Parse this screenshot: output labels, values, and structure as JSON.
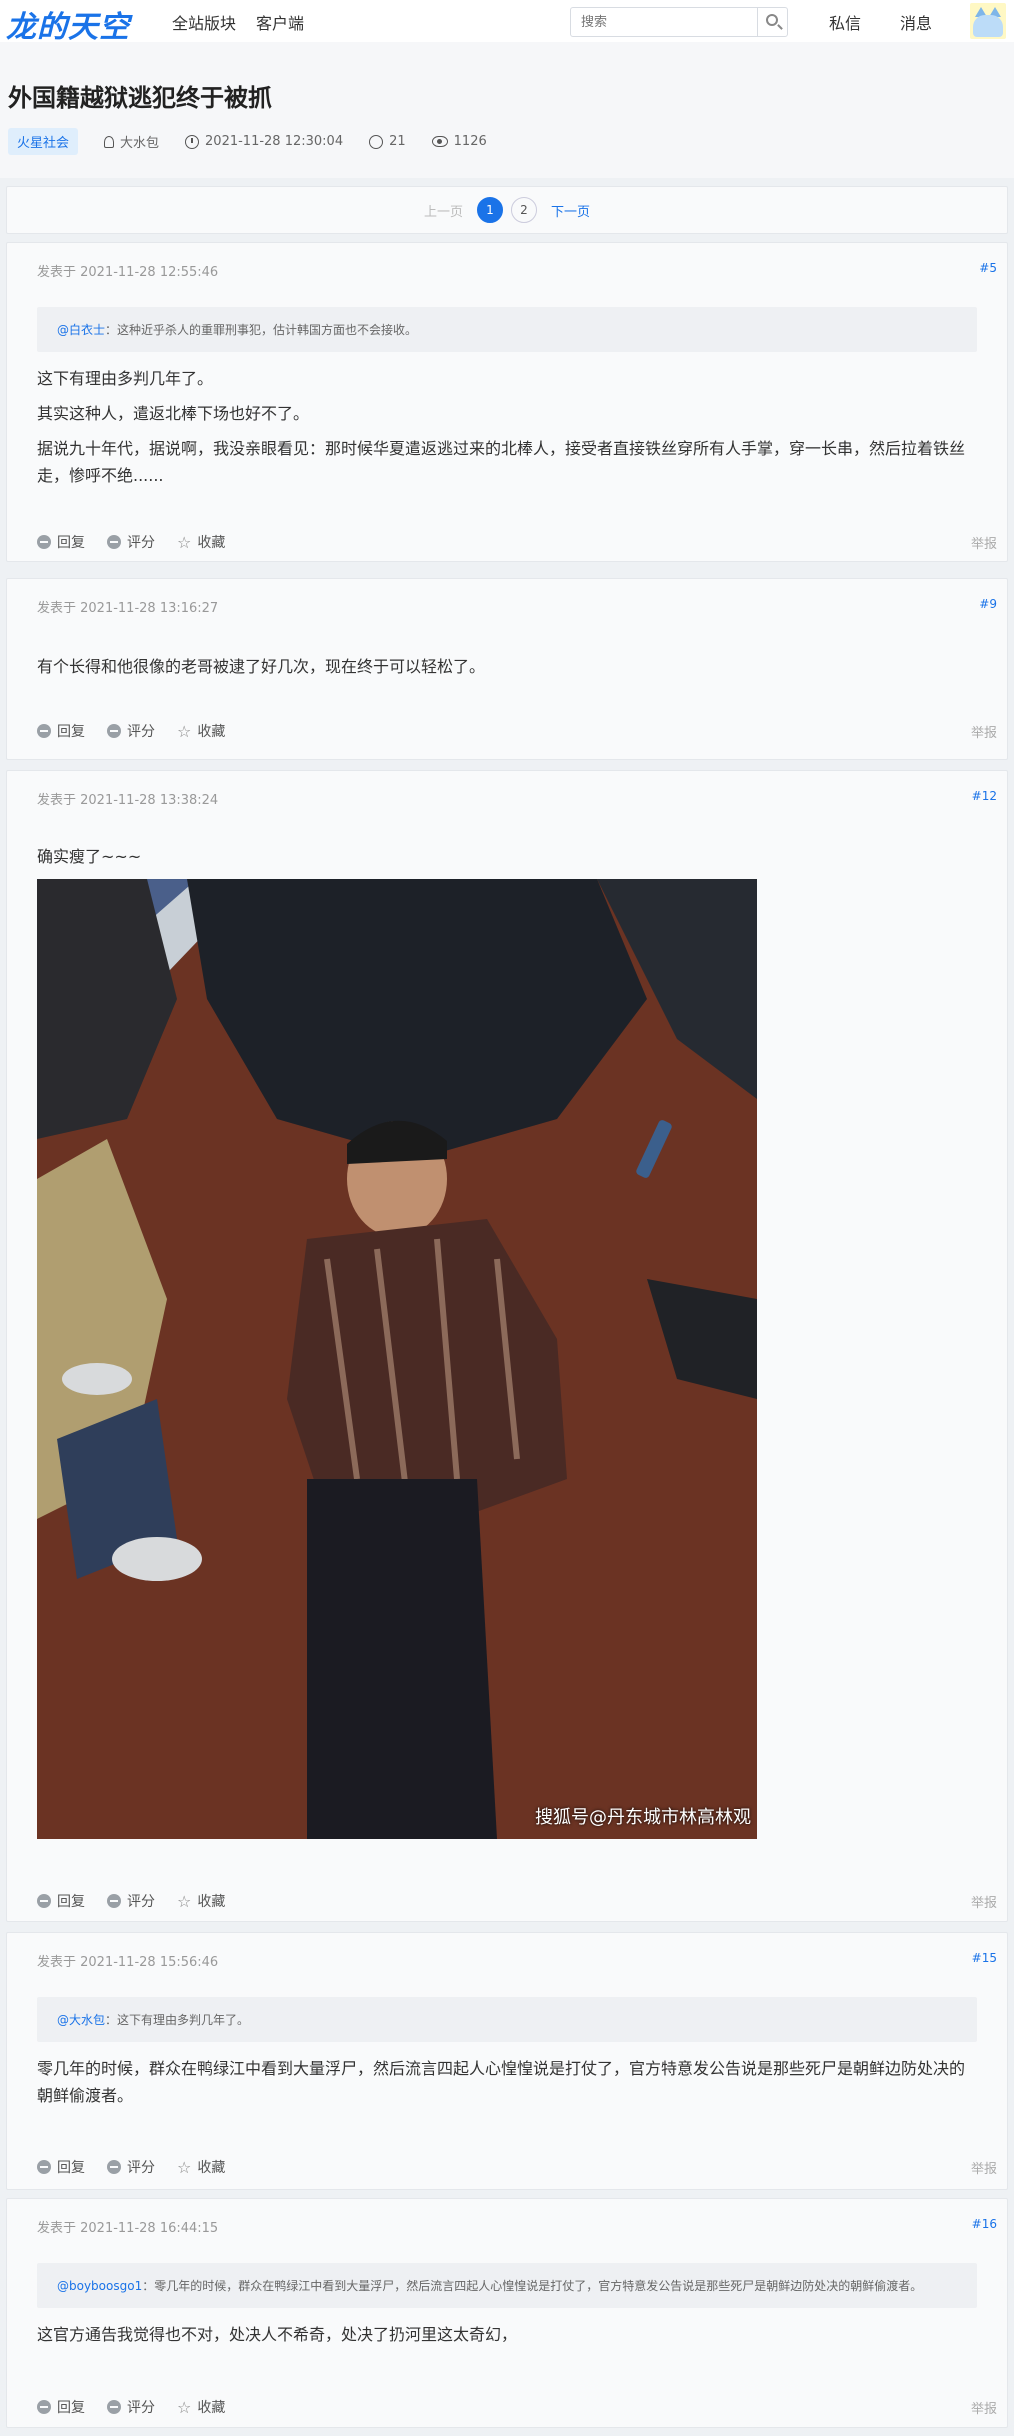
{
  "header": {
    "logo": "龙的天空",
    "nav": [
      "全站版块",
      "客户端"
    ],
    "search_placeholder": "搜索",
    "messages": "私信",
    "notifications": "消息"
  },
  "thread": {
    "title": "外国籍越狱逃犯终于被抓",
    "tag": "火星社会",
    "author": "大水包",
    "time": "2021-11-28 12:30:04",
    "replies": "21",
    "views": "1126"
  },
  "pager": {
    "prev": "上一页",
    "pages": [
      "1",
      "2"
    ],
    "next": "下一页"
  },
  "actions": {
    "reply": "回复",
    "rate": "评分",
    "fav": "收藏",
    "report": "举报"
  },
  "posts": [
    {
      "time": "发表于 2021-11-28 12:55:46",
      "floor": "#5",
      "quote_user": "@白衣士",
      "quote_text": "：这种近乎杀人的重罪刑事犯，估计韩国方面也不会接收。",
      "lines": [
        "这下有理由多判几年了。",
        "其实这种人，遣返北棒下场也好不了。",
        "据说九十年代，据说啊，我没亲眼看见：那时候华夏遣返逃过来的北棒人，接受者直接铁丝穿所有人手掌，穿一长串，然后拉着铁丝走，惨呼不绝......"
      ]
    },
    {
      "time": "发表于 2021-11-28 13:16:27",
      "floor": "#9",
      "lines": [
        "有个长得和他很像的老哥被逮了好几次，现在终于可以轻松了。"
      ]
    },
    {
      "time": "发表于 2021-11-28 13:38:24",
      "floor": "#12",
      "lines": [
        "确实瘦了~~~"
      ],
      "image_watermark": "搜狐号@丹东城市林高林观"
    },
    {
      "time": "发表于 2021-11-28 15:56:46",
      "floor": "#15",
      "quote_user": "@大水包",
      "quote_text": "：这下有理由多判几年了。",
      "lines": [
        "零几年的时候，群众在鸭绿江中看到大量浮尸，然后流言四起人心惶惶说是打仗了，官方特意发公告说是那些死尸是朝鲜边防处决的朝鲜偷渡者。"
      ]
    },
    {
      "time": "发表于 2021-11-28 16:44:15",
      "floor": "#16",
      "quote_user": "@boyboosgo1",
      "quote_text": "：零几年的时候，群众在鸭绿江中看到大量浮尸，然后流言四起人心惶惶说是打仗了，官方特意发公告说是那些死尸是朝鲜边防处决的朝鲜偷渡者。",
      "lines": [
        "这官方通告我觉得也不对，处决人不希奇，处决了扔河里这太奇幻，"
      ]
    }
  ]
}
